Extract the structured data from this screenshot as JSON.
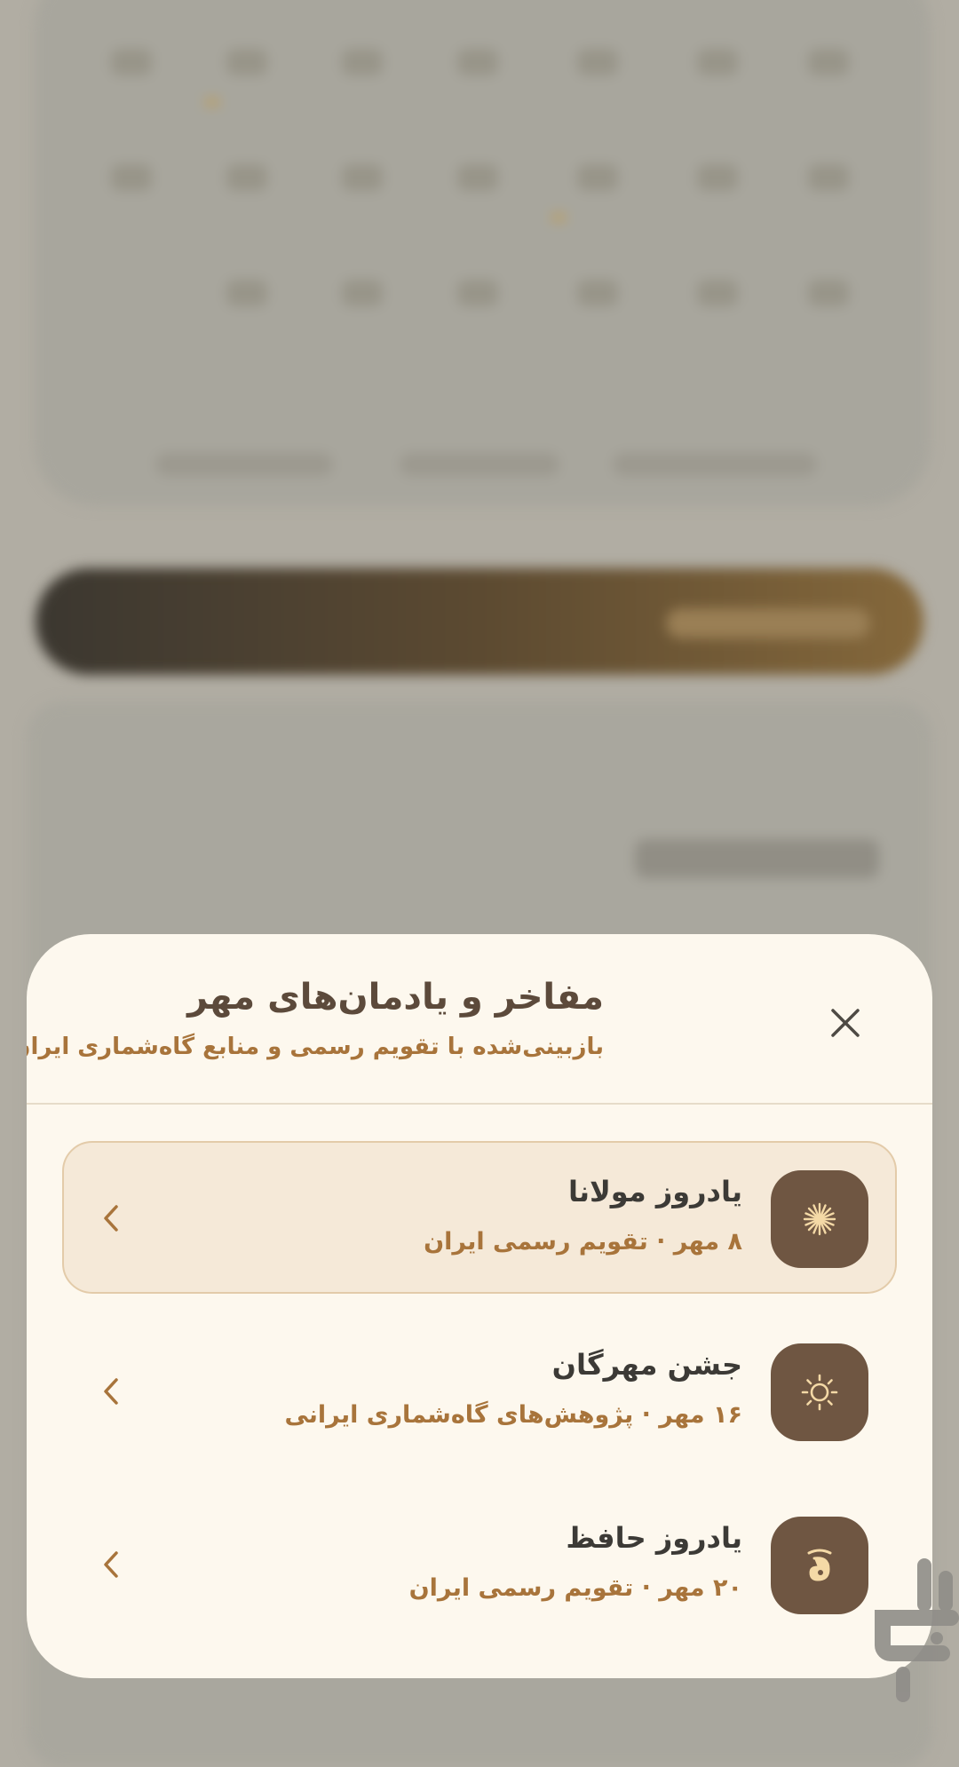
{
  "sheet": {
    "title": "مفاخر و یادمان‌های مهر",
    "subtitle": "بازبینی‌شده با تقویم رسمی و منابع گاه‌شماری ایران",
    "close_icon": "close-icon"
  },
  "items": [
    {
      "title": "یادروز مولانا",
      "meta": "۸ مهر · تقویم رسمی ایران",
      "icon": "sunburst-icon",
      "highlighted": true
    },
    {
      "title": "جشن مهرگان",
      "meta": "۱۶ مهر · پژوهش‌های گاه‌شماری ایرانی",
      "icon": "sun-icon",
      "highlighted": false
    },
    {
      "title": "یادروز حافظ",
      "meta": "۲۰ مهر · تقویم رسمی ایران",
      "icon": "calligraphy-icon",
      "highlighted": false
    }
  ],
  "colors": {
    "sheet_background": "#fdf8ee",
    "accent": "#a8743b",
    "icon_tile": "#6f5642",
    "highlight_background": "#f5e9d8",
    "title_text": "#3c3a36"
  },
  "watermark": {
    "icon": "bazaar-logo-icon"
  }
}
